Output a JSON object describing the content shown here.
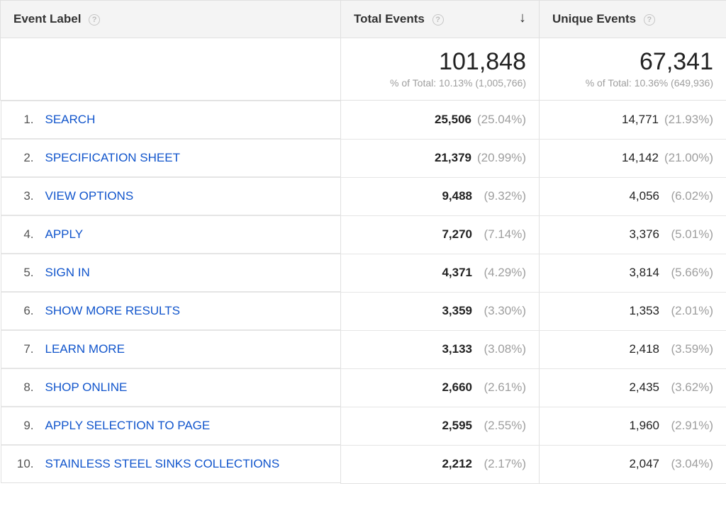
{
  "columns": {
    "label": "Event Label",
    "total": "Total Events",
    "unique": "Unique Events"
  },
  "summary": {
    "total": {
      "value": "101,848",
      "sub": "% of Total: 10.13% (1,005,766)"
    },
    "unique": {
      "value": "67,341",
      "sub": "% of Total: 10.36% (649,936)"
    }
  },
  "rows": [
    {
      "idx": "1.",
      "label": "SEARCH",
      "total": {
        "v": "25,506",
        "p": "(25.04%)"
      },
      "unique": {
        "v": "14,771",
        "p": "(21.93%)"
      }
    },
    {
      "idx": "2.",
      "label": "SPECIFICATION SHEET",
      "total": {
        "v": "21,379",
        "p": "(20.99%)"
      },
      "unique": {
        "v": "14,142",
        "p": "(21.00%)"
      }
    },
    {
      "idx": "3.",
      "label": "VIEW OPTIONS",
      "total": {
        "v": "9,488",
        "p": "(9.32%)"
      },
      "unique": {
        "v": "4,056",
        "p": "(6.02%)"
      }
    },
    {
      "idx": "4.",
      "label": "APPLY",
      "total": {
        "v": "7,270",
        "p": "(7.14%)"
      },
      "unique": {
        "v": "3,376",
        "p": "(5.01%)"
      }
    },
    {
      "idx": "5.",
      "label": "SIGN IN",
      "total": {
        "v": "4,371",
        "p": "(4.29%)"
      },
      "unique": {
        "v": "3,814",
        "p": "(5.66%)"
      }
    },
    {
      "idx": "6.",
      "label": "SHOW MORE RESULTS",
      "total": {
        "v": "3,359",
        "p": "(3.30%)"
      },
      "unique": {
        "v": "1,353",
        "p": "(2.01%)"
      }
    },
    {
      "idx": "7.",
      "label": "LEARN MORE",
      "total": {
        "v": "3,133",
        "p": "(3.08%)"
      },
      "unique": {
        "v": "2,418",
        "p": "(3.59%)"
      }
    },
    {
      "idx": "8.",
      "label": "SHOP ONLINE",
      "total": {
        "v": "2,660",
        "p": "(2.61%)"
      },
      "unique": {
        "v": "2,435",
        "p": "(3.62%)"
      }
    },
    {
      "idx": "9.",
      "label": "APPLY SELECTION TO PAGE",
      "total": {
        "v": "2,595",
        "p": "(2.55%)"
      },
      "unique": {
        "v": "1,960",
        "p": "(2.91%)"
      }
    },
    {
      "idx": "10.",
      "label": "STAINLESS STEEL SINKS COLLECTIONS",
      "total": {
        "v": "2,212",
        "p": "(2.17%)"
      },
      "unique": {
        "v": "2,047",
        "p": "(3.04%)"
      }
    }
  ]
}
